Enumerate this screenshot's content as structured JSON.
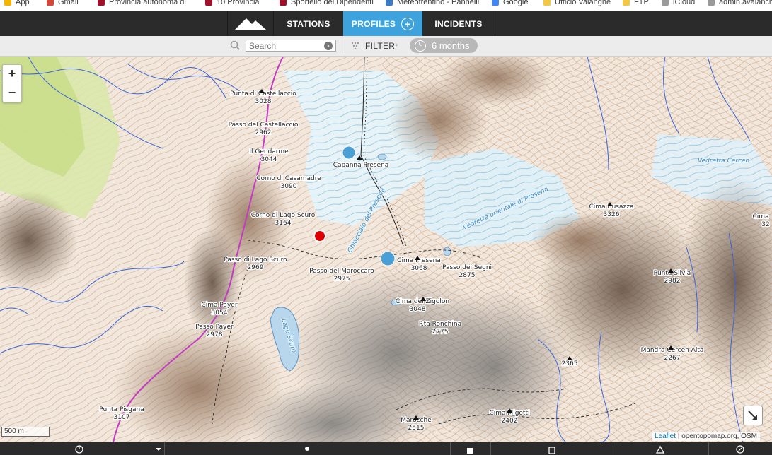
{
  "browser": {
    "bookmarks": [
      {
        "label": "App",
        "color": "#f4b400"
      },
      {
        "label": "Gmail",
        "color": "#d44638"
      },
      {
        "label": "Provincia autonoma di",
        "color": "#a0102a"
      },
      {
        "label": "10 Provincia",
        "color": "#a0102a"
      },
      {
        "label": "Sportello dei Dipendenti",
        "color": "#a0102a"
      },
      {
        "label": "Meteotrentino - Pannelli",
        "color": "#3a79c6"
      },
      {
        "label": "Google",
        "color": "#4285f4"
      },
      {
        "label": "Ufficio Valanghe",
        "color": "#f2c744"
      },
      {
        "label": "FTP",
        "color": "#f2c744"
      },
      {
        "label": "iCloud",
        "color": "#9a9a9a"
      },
      {
        "label": "admin.avalanche",
        "color": "#9a9a9a"
      }
    ]
  },
  "nav": {
    "stations": "STATIONS",
    "profiles": "PROFILES",
    "profiles_add": "+",
    "incidents": "INCIDENTS",
    "active_color": "#3ea3dc"
  },
  "toolbar": {
    "search_placeholder": "Search",
    "search_clear": "×",
    "filter_label": "FILTER",
    "filter_caret": "›",
    "period_label": "6 months"
  },
  "map": {
    "zoom_in": "+",
    "zoom_out": "−",
    "scale": "500 m",
    "attribution_link": "Leaflet",
    "attribution_text": "| opentopomap.org, OSM",
    "peaks": [
      {
        "name": "Punta di Castellaccio",
        "elev": "3028"
      },
      {
        "name": "Passo del Castellaccio",
        "elev": "2962"
      },
      {
        "name": "Il Gendarme",
        "elev": "3044"
      },
      {
        "name": "Corno di Casamadre",
        "elev": "3090"
      },
      {
        "name": "Capanna Presena",
        "elev": ""
      },
      {
        "name": "Corno di Lago Scuro",
        "elev": "3164"
      },
      {
        "name": "Passo di Lago Scuro",
        "elev": "2969"
      },
      {
        "name": "Passo del Maroccaro",
        "elev": "2975"
      },
      {
        "name": "Cima Presena",
        "elev": "3068"
      },
      {
        "name": "Passo dei Segni",
        "elev": "2875"
      },
      {
        "name": "Cima del Zigolon",
        "elev": "3048"
      },
      {
        "name": "P.ta Ronchina",
        "elev": "2775"
      },
      {
        "name": "Cima Payer",
        "elev": "3054"
      },
      {
        "name": "Passo Payer",
        "elev": "2978"
      },
      {
        "name": "Punta Pisgana",
        "elev": "3107"
      },
      {
        "name": "Cima Busazza",
        "elev": "3326"
      },
      {
        "name": "Punta Silvia",
        "elev": "2982"
      },
      {
        "name": "Mandra Cercen Alta",
        "elev": "2267"
      },
      {
        "name": "",
        "elev": "2365"
      },
      {
        "name": "Cima Migotti",
        "elev": "2402"
      },
      {
        "name": "Marocche",
        "elev": "2515"
      },
      {
        "name": "Cima",
        "elev": "32"
      }
    ],
    "glaciers": [
      {
        "name": "Ghiacciaio del Presena"
      },
      {
        "name": "Vedretta orientale di Presena"
      },
      {
        "name": "Vedretta Cercen"
      },
      {
        "name": "Lago Scuro"
      }
    ],
    "markers": [
      {
        "name": "profile-marker-capanna",
        "color": "#4a9fd4"
      },
      {
        "name": "incident-marker-red",
        "color": "#e10000"
      },
      {
        "name": "profile-marker-presena",
        "color": "#4a9fd4"
      }
    ]
  }
}
